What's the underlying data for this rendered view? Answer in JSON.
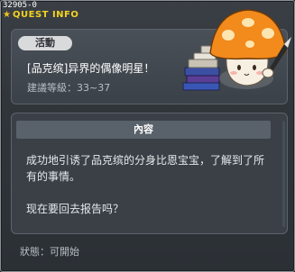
{
  "window": {
    "quest_id": "32905-0",
    "title": "QUEST INFO"
  },
  "quest": {
    "category": "活動",
    "name": "[品克缤]异界的偶像明星！",
    "level": "建議等級：33~37"
  },
  "content": {
    "header": "內容",
    "line1": "成功地引诱了品克缤的分身比恩宝宝，了解到了所",
    "line2": "有的事情。",
    "line3": "现在要回去报告吗？"
  },
  "status": {
    "text": "狀態：可開始"
  },
  "colors": {
    "title": "#f4d21f",
    "panel": "#3a4046",
    "header_bar": "#59616a",
    "pill": "#d9dadc"
  },
  "icons": {
    "title_icon": "star-icon",
    "npc": "mushroom-npc-illustration"
  }
}
